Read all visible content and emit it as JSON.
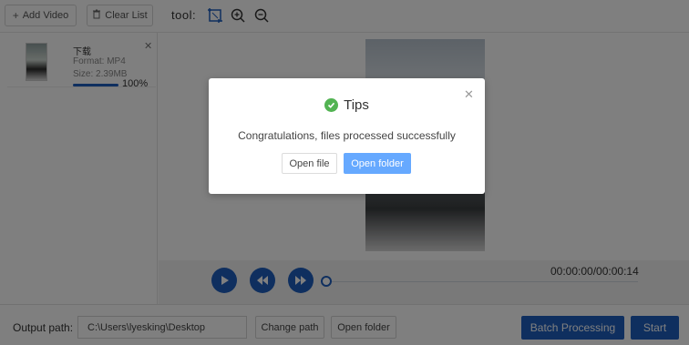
{
  "toolbar": {
    "add_video_label": "Add Video",
    "clear_list_label": "Clear List",
    "tool_label": "tool:"
  },
  "file_list": [
    {
      "name": "下载",
      "format": "Format:  MP4",
      "size": "Size:  2.39MB",
      "progress_percent": 100,
      "progress_text": "100%"
    }
  ],
  "player": {
    "time": "00:00:00/00:00:14",
    "position_fraction": 0
  },
  "output": {
    "label": "Output path:",
    "path": "C:\\Users\\lyesking\\Desktop",
    "change_path_label": "Change path",
    "open_folder_label": "Open folder",
    "batch_label": "Batch Processing",
    "start_label": "Start"
  },
  "dialog": {
    "title": "Tips",
    "message": "Congratulations, files processed successfully",
    "open_file_label": "Open file",
    "open_folder_label": "Open folder"
  },
  "colors": {
    "accent": "#1f5fbf",
    "dialog_primary": "#66a9ff",
    "success": "#52b352"
  }
}
